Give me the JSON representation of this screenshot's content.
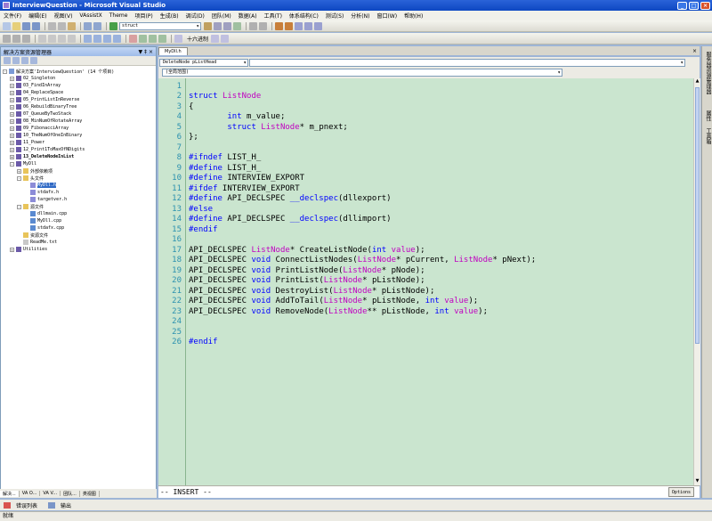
{
  "window": {
    "title": "InterviewQuestion - Microsoft Visual Studio"
  },
  "menu": [
    "文件(F)",
    "编辑(E)",
    "视图(V)",
    "VAssistX",
    "Theme",
    "项目(P)",
    "生成(B)",
    "调试(D)",
    "团队(M)",
    "数据(A)",
    "工具(T)",
    "体系结构(C)",
    "测试(S)",
    "分析(N)",
    "窗口(W)",
    "帮助(H)"
  ],
  "toolbar": {
    "find_value": "struct",
    "hex_label": "十六进制"
  },
  "solution_explorer": {
    "title": "解决方案资源管理器",
    "pin": "▼ ‡ ×",
    "items": [
      {
        "label": "02_Singleton",
        "indent": 1,
        "exp": "+",
        "icon": "proj"
      },
      {
        "label": "03_FindInArray",
        "indent": 1,
        "exp": "+",
        "icon": "proj"
      },
      {
        "label": "04_ReplaceSpace",
        "indent": 1,
        "exp": "+",
        "icon": "proj"
      },
      {
        "label": "05_PrintListInReverse",
        "indent": 1,
        "exp": "+",
        "icon": "proj"
      },
      {
        "label": "06_RebuildBinaryTree",
        "indent": 1,
        "exp": "+",
        "icon": "proj"
      },
      {
        "label": "07_QueueByTwoStack",
        "indent": 1,
        "exp": "+",
        "icon": "proj"
      },
      {
        "label": "08_MinNumOfRotateArray",
        "indent": 1,
        "exp": "+",
        "icon": "proj"
      },
      {
        "label": "09_FibonacciArray",
        "indent": 1,
        "exp": "+",
        "icon": "proj"
      },
      {
        "label": "10_TheNumOfOneInBinary",
        "indent": 1,
        "exp": "+",
        "icon": "proj"
      },
      {
        "label": "11_Power",
        "indent": 1,
        "exp": "+",
        "icon": "proj"
      },
      {
        "label": "12_Print1ToMaxOfNDigits",
        "indent": 1,
        "exp": "+",
        "icon": "proj"
      },
      {
        "label": "13_DeleteNodeInList",
        "indent": 1,
        "exp": "+",
        "icon": "proj",
        "bold": true
      },
      {
        "label": "MyDll",
        "indent": 1,
        "exp": "-",
        "icon": "proj"
      },
      {
        "label": "外部依赖项",
        "indent": 2,
        "exp": "+",
        "icon": "folder"
      },
      {
        "label": "头文件",
        "indent": 2,
        "exp": "-",
        "icon": "folder"
      },
      {
        "label": "MyDll.h",
        "indent": 3,
        "exp": "",
        "icon": "h",
        "selected": true
      },
      {
        "label": "stdafx.h",
        "indent": 3,
        "exp": "",
        "icon": "h"
      },
      {
        "label": "targetver.h",
        "indent": 3,
        "exp": "",
        "icon": "h"
      },
      {
        "label": "源文件",
        "indent": 2,
        "exp": "-",
        "icon": "folder"
      },
      {
        "label": "dllmain.cpp",
        "indent": 3,
        "exp": "",
        "icon": "cpp"
      },
      {
        "label": "MyDll.cpp",
        "indent": 3,
        "exp": "",
        "icon": "cpp"
      },
      {
        "label": "stdafx.cpp",
        "indent": 3,
        "exp": "",
        "icon": "cpp"
      },
      {
        "label": "资源文件",
        "indent": 2,
        "exp": "",
        "icon": "folder"
      },
      {
        "label": "ReadMe.txt",
        "indent": 2,
        "exp": "",
        "icon": "txt"
      },
      {
        "label": "Utilities",
        "indent": 1,
        "exp": "+",
        "icon": "proj"
      }
    ],
    "solution_row": "解决方案'InterviewQuestion' (14 个项目)",
    "tabs": [
      "解决...",
      "VA O...",
      "VA V...",
      "团队...",
      "类视图"
    ]
  },
  "editor": {
    "tab": "MyDll.h",
    "close": "×",
    "nav_left": "DeleteNode pListHead",
    "nav_scope": "(全局范围)",
    "lines": [
      {
        "n": "1",
        "code": ""
      },
      {
        "n": "2",
        "code": "struct ListNode",
        "html": "<span class='kw'>struct</span> <span class='ty'>ListNode</span>"
      },
      {
        "n": "3",
        "code": "{"
      },
      {
        "n": "4",
        "code": "        int m_value;",
        "html": "        <span class='kw'>int</span> m_value;"
      },
      {
        "n": "5",
        "code": "        struct ListNode* m_pnext;",
        "html": "        <span class='kw'>struct</span> <span class='ty'>ListNode</span>* m_pnext;"
      },
      {
        "n": "6",
        "code": "};"
      },
      {
        "n": "7",
        "code": ""
      },
      {
        "n": "8",
        "code": "#ifndef LIST_H_",
        "html": "<span class='pp'>#ifndef</span> LIST_H_"
      },
      {
        "n": "9",
        "code": "#define LIST_H_",
        "html": "<span class='pp'>#define</span> LIST_H_"
      },
      {
        "n": "10",
        "code": "#define INTERVIEW_EXPORT",
        "html": "<span class='pp'>#define</span> INTERVIEW_EXPORT"
      },
      {
        "n": "11",
        "code": "#ifdef INTERVIEW_EXPORT",
        "html": "<span class='pp'>#ifdef</span> INTERVIEW_EXPORT"
      },
      {
        "n": "12",
        "code": "#define API_DECLSPEC __declspec(dllexport)",
        "html": "<span class='pp'>#define</span> API_DECLSPEC <span class='kw'>__declspec</span>(dllexport)"
      },
      {
        "n": "13",
        "code": "#else",
        "html": "<span class='pp'>#else</span>"
      },
      {
        "n": "14",
        "code": "#define API_DECLSPEC __declspec(dllimport)",
        "html": "<span class='pp'>#define</span> API_DECLSPEC <span class='kw'>__declspec</span>(dllimport)"
      },
      {
        "n": "15",
        "code": "#endif",
        "html": "<span class='pp'>#endif</span>"
      },
      {
        "n": "16",
        "code": ""
      },
      {
        "n": "17",
        "code": "API_DECLSPEC ListNode* CreateListNode(int value);",
        "html": "API_DECLSPEC <span class='ty'>ListNode</span>* CreateListNode(<span class='kw'>int</span> <span class='ty'>value</span>);"
      },
      {
        "n": "18",
        "code": "API_DECLSPEC void ConnectListNodes(ListNode* pCurrent, ListNode* pNext);",
        "html": "API_DECLSPEC <span class='kw'>void</span> ConnectListNodes(<span class='ty'>ListNode</span>* pCurrent, <span class='ty'>ListNode</span>* pNext);"
      },
      {
        "n": "19",
        "code": "API_DECLSPEC void PrintListNode(ListNode* pNode);",
        "html": "API_DECLSPEC <span class='kw'>void</span> PrintListNode(<span class='ty'>ListNode</span>* pNode);"
      },
      {
        "n": "20",
        "code": "API_DECLSPEC void PrintList(ListNode* pListNode);",
        "html": "API_DECLSPEC <span class='kw'>void</span> PrintList(<span class='ty'>ListNode</span>* pListNode);"
      },
      {
        "n": "21",
        "code": "API_DECLSPEC void DestroyList(ListNode* pListNode);",
        "html": "API_DECLSPEC <span class='kw'>void</span> DestroyList(<span class='ty'>ListNode</span>* pListNode);"
      },
      {
        "n": "22",
        "code": "API_DECLSPEC void AddToTail(ListNode* pListNode, int value);",
        "html": "API_DECLSPEC <span class='kw'>void</span> AddToTail(<span class='ty'>ListNode</span>* pListNode, <span class='kw'>int</span> <span class='ty'>value</span>);"
      },
      {
        "n": "23",
        "code": "API_DECLSPEC void RemoveNode(ListNode** pListNode, int value);",
        "html": "API_DECLSPEC <span class='kw'>void</span> RemoveNode(<span class='ty'>ListNode</span>** pListNode, <span class='kw'>int</span> <span class='ty'>value</span>);"
      },
      {
        "n": "24",
        "code": ""
      },
      {
        "n": "25",
        "code": ""
      },
      {
        "n": "26",
        "code": "#endif",
        "html": "<span class='pp'>#endif</span>"
      }
    ],
    "command_text": "-- INSERT --",
    "options_label": "Options"
  },
  "right_strip": [
    "服务器资源管理器",
    "属性",
    "工具箱"
  ],
  "bottom_tabs": [
    "错误列表",
    "输出"
  ],
  "status": "就绪",
  "colors": {
    "code_bg": "#cae5cf",
    "keyword": "#0000ff",
    "type": "#c000c0",
    "line_number": "#2b91af",
    "selection": "#316ac5"
  }
}
